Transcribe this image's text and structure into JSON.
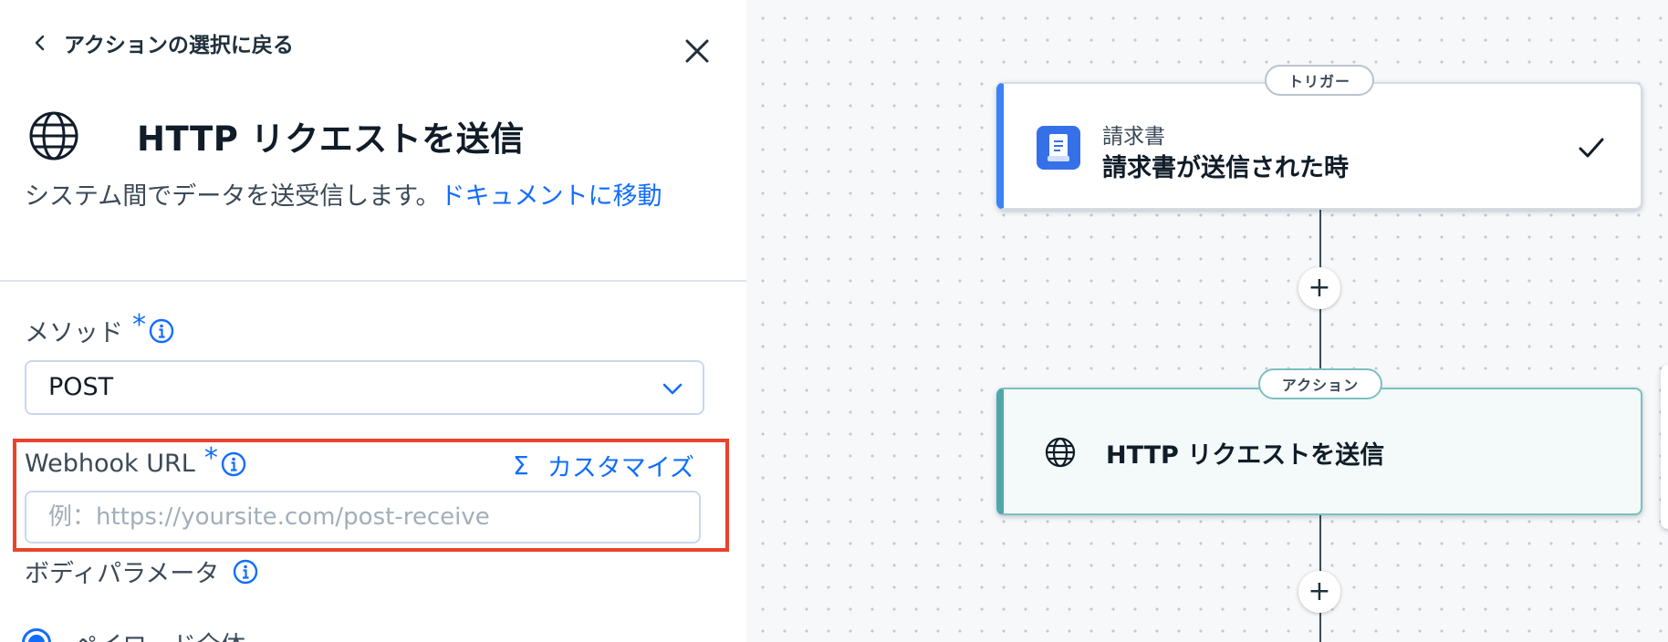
{
  "panel": {
    "back_label": "アクションの選択に戻る",
    "title": "HTTP リクエストを送信",
    "description": "システム間でデータを送受信します。",
    "doc_link": "ドキュメントに移動",
    "method": {
      "label": "メソッド",
      "required_mark": "*",
      "value": "POST"
    },
    "webhook": {
      "label": "Webhook URL",
      "required_mark": "*",
      "customize_symbol": "Σ",
      "customize_label": "カスタマイズ",
      "placeholder": "例：https://yoursite.com/post-receive",
      "value": ""
    },
    "body_params": {
      "label": "ボディパラメータ",
      "option_selected": "ペイロード全体"
    }
  },
  "canvas": {
    "trigger": {
      "pill": "トリガー",
      "subtitle": "請求書",
      "title": "請求書が送信された時",
      "icon": "invoice-icon",
      "status_icon": "check-icon"
    },
    "action": {
      "pill": "アクション",
      "title": "HTTP リクエストを送信",
      "icon": "globe-icon"
    },
    "add_step_symbol": "+"
  },
  "colors": {
    "accent": "#116dff",
    "highlight": "#e8432c",
    "trigger_bar": "#3b82f6",
    "action_bar": "#4ea8aa"
  }
}
